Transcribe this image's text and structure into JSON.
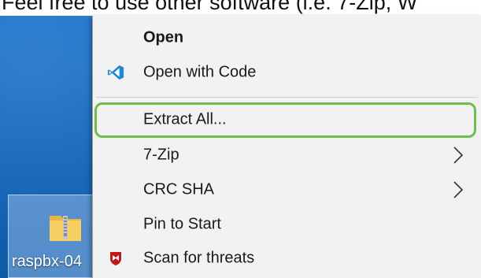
{
  "caption": "Feel free to use other software (i.e. 7-Zip, W",
  "desktop": {
    "icon_label": "raspbx-04",
    "icon_name": "zip-folder-icon"
  },
  "menu": {
    "items": [
      {
        "label": "Open",
        "bold": true,
        "icon": ""
      },
      {
        "label": "Open with Code",
        "bold": false,
        "icon": "vscode-icon"
      },
      {
        "label": "Extract All...",
        "bold": false,
        "icon": "",
        "highlighted": true
      },
      {
        "label": "7-Zip",
        "bold": false,
        "icon": "",
        "submenu": true
      },
      {
        "label": "CRC SHA",
        "bold": false,
        "icon": "",
        "submenu": true
      },
      {
        "label": "Pin to Start",
        "bold": false,
        "icon": ""
      },
      {
        "label": "Scan for threats",
        "bold": false,
        "icon": "mcafee-shield-icon"
      }
    ]
  },
  "colors": {
    "menu_bg": "#f2f2f2",
    "highlight_border": "#6bbf4a",
    "vscode_blue": "#1f8ad2",
    "mcafee_red": "#c01818",
    "desktop_blue": "#1566b8"
  }
}
